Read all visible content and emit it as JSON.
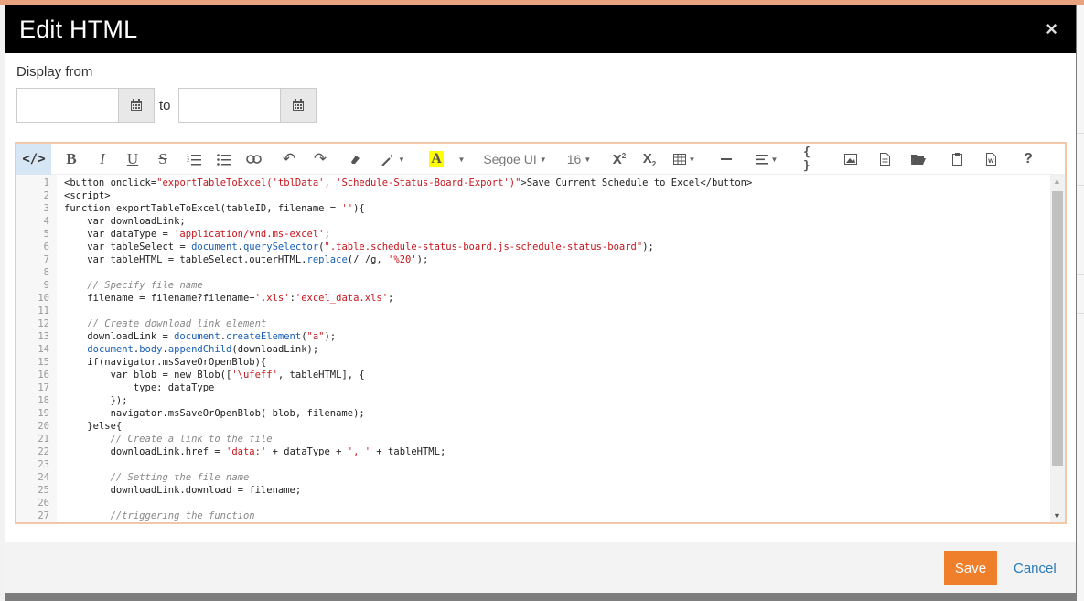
{
  "dialog": {
    "title": "Edit HTML",
    "close_label": "×"
  },
  "display_from": {
    "label": "Display from",
    "from_value": "",
    "to_label": "to",
    "to_value": ""
  },
  "toolbar": {
    "code_view": "</>",
    "font_name": "Segoe UI",
    "font_size": "16",
    "help": "?"
  },
  "code_lines": [
    {
      "n": "1",
      "text": "<button onclick=\"exportTableToExcel('tblData', 'Schedule-Status-Board-Export')\">Save Current Schedule to Excel</button>"
    },
    {
      "n": "2",
      "text": "<script>"
    },
    {
      "n": "3",
      "text": "function exportTableToExcel(tableID, filename = ''){"
    },
    {
      "n": "4",
      "text": "    var downloadLink;"
    },
    {
      "n": "5",
      "text": "    var dataType = 'application/vnd.ms-excel';"
    },
    {
      "n": "6",
      "text": "    var tableSelect = document.querySelector(\".table.schedule-status-board.js-schedule-status-board\");"
    },
    {
      "n": "7",
      "text": "    var tableHTML = tableSelect.outerHTML.replace(/ /g, '%20');"
    },
    {
      "n": "8",
      "text": ""
    },
    {
      "n": "9",
      "text": "    // Specify file name"
    },
    {
      "n": "10",
      "text": "    filename = filename?filename+'.xls':'excel_data.xls';"
    },
    {
      "n": "11",
      "text": ""
    },
    {
      "n": "12",
      "text": "    // Create download link element"
    },
    {
      "n": "13",
      "text": "    downloadLink = document.createElement(\"a\");"
    },
    {
      "n": "14",
      "text": "    document.body.appendChild(downloadLink);"
    },
    {
      "n": "15",
      "text": "    if(navigator.msSaveOrOpenBlob){"
    },
    {
      "n": "16",
      "text": "        var blob = new Blob(['\\ufeff', tableHTML], {"
    },
    {
      "n": "17",
      "text": "            type: dataType"
    },
    {
      "n": "18",
      "text": "        });"
    },
    {
      "n": "19",
      "text": "        navigator.msSaveOrOpenBlob( blob, filename);"
    },
    {
      "n": "20",
      "text": "    }else{"
    },
    {
      "n": "21",
      "text": "        // Create a link to the file"
    },
    {
      "n": "22",
      "text": "        downloadLink.href = 'data:' + dataType + ', ' + tableHTML;"
    },
    {
      "n": "23",
      "text": ""
    },
    {
      "n": "24",
      "text": "        // Setting the file name"
    },
    {
      "n": "25",
      "text": "        downloadLink.download = filename;"
    },
    {
      "n": "26",
      "text": ""
    },
    {
      "n": "27",
      "text": "        //triggering the function"
    }
  ],
  "footer": {
    "save_label": "Save",
    "cancel_label": "Cancel"
  },
  "colors": {
    "header_bg": "#000000",
    "save_bg": "#f07f2b",
    "cancel_text": "#2a7ab7",
    "editor_border": "#f2c6a8"
  }
}
